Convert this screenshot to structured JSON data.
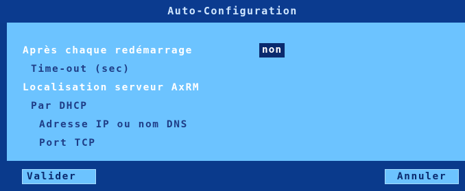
{
  "dialog": {
    "title": "Auto-Configuration"
  },
  "settings": {
    "after_restart_label": "Après chaque redémarrage",
    "after_restart_value": "non",
    "timeout_label": "Time-out (sec)",
    "axrm_location_label": "Localisation serveur AxRM",
    "dhcp_label": "Par DHCP",
    "ip_dns_label": "Adresse IP ou nom DNS",
    "tcp_port_label": "Port TCP"
  },
  "buttons": {
    "validate_label": "Valider",
    "cancel_label": "Annuler"
  },
  "colors": {
    "frame": "#0a3a8c",
    "panel": "#6cc3ff",
    "active_text": "#ffffff",
    "dim_text": "#1f3d86",
    "selected_value_bg": "#0a2a6e"
  }
}
